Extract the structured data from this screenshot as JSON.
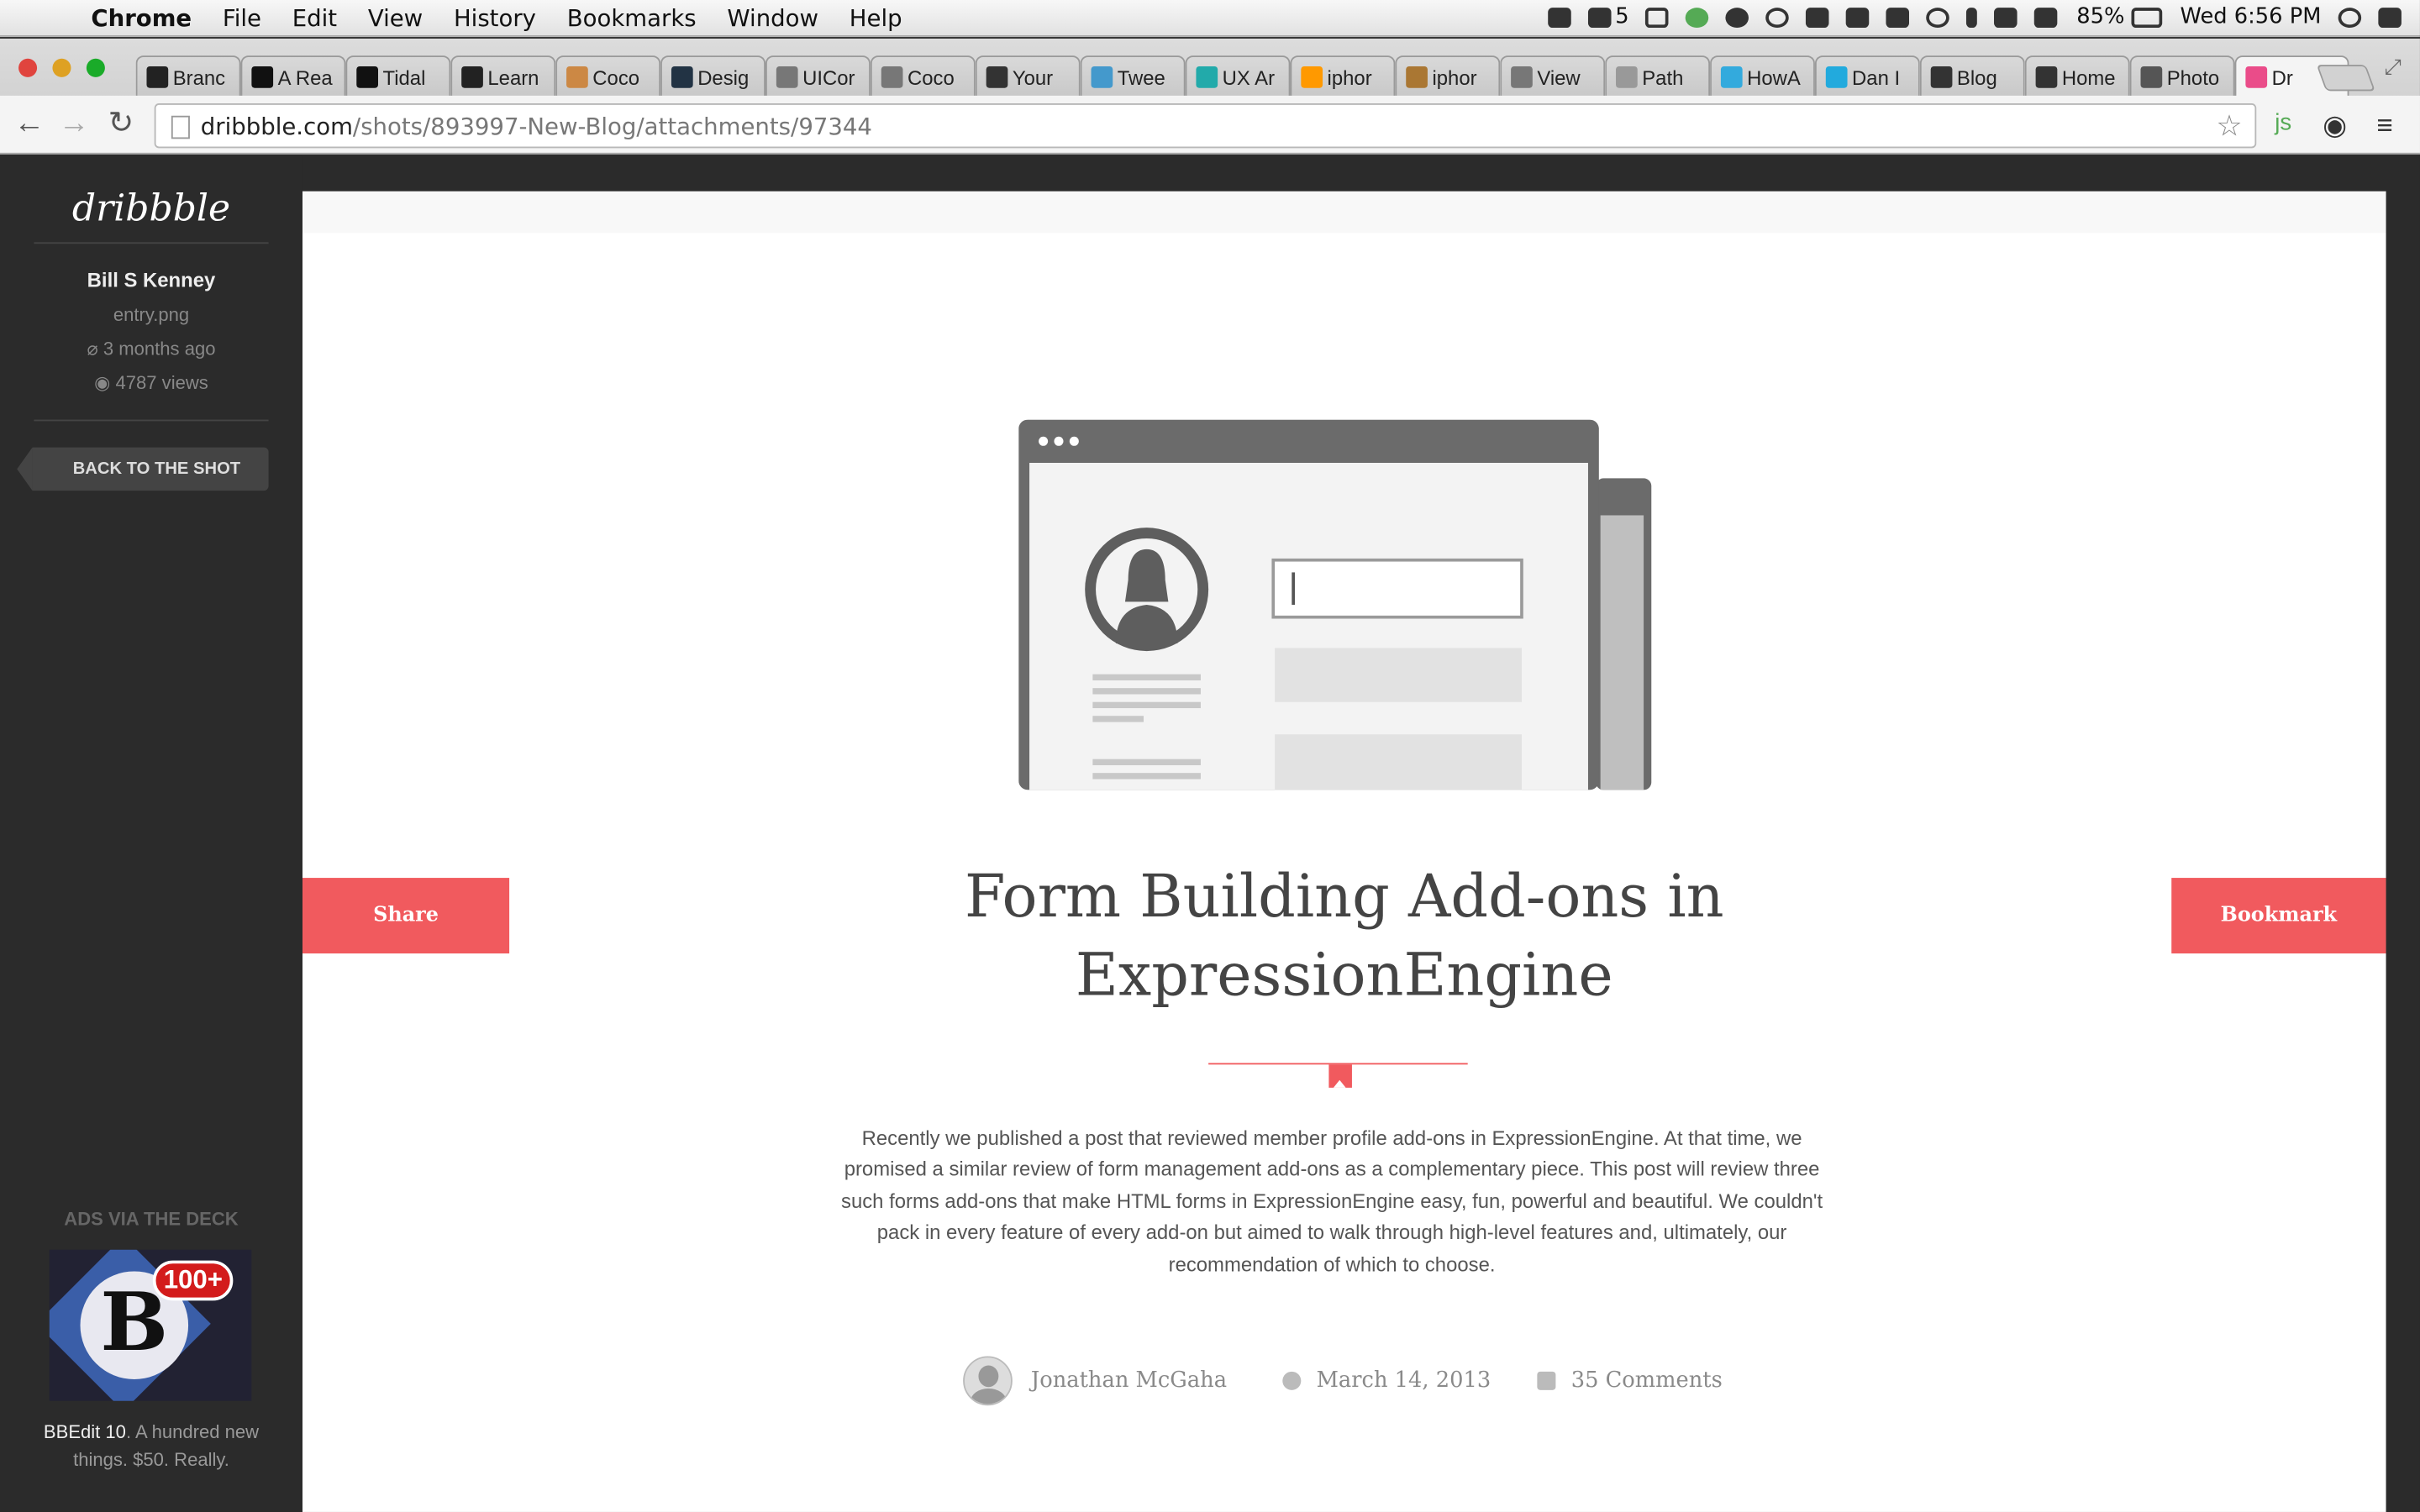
{
  "menubar": {
    "app": "Chrome",
    "menus": [
      "File",
      "Edit",
      "View",
      "History",
      "Bookmarks",
      "Window",
      "Help"
    ],
    "adobe_badge": "5",
    "battery": "85%",
    "clock": "Wed 6:56 PM"
  },
  "tabs": [
    {
      "label": "Branc",
      "color": "#222"
    },
    {
      "label": "A Rea",
      "color": "#111"
    },
    {
      "label": "Tidal",
      "color": "#111"
    },
    {
      "label": "Learn",
      "color": "#222"
    },
    {
      "label": "Coco",
      "color": "#c84"
    },
    {
      "label": "Desig",
      "color": "#234"
    },
    {
      "label": "UICor",
      "color": "#777"
    },
    {
      "label": "Coco",
      "color": "#777"
    },
    {
      "label": "Your",
      "color": "#333"
    },
    {
      "label": "Twee",
      "color": "#49c"
    },
    {
      "label": "UX Ar",
      "color": "#2aa"
    },
    {
      "label": "iphor",
      "color": "#f90"
    },
    {
      "label": "iphor",
      "color": "#a73"
    },
    {
      "label": "View",
      "color": "#777"
    },
    {
      "label": "Path",
      "color": "#999"
    },
    {
      "label": "HowA",
      "color": "#3ad"
    },
    {
      "label": "Dan I",
      "color": "#2ad"
    },
    {
      "label": "Blog",
      "color": "#333"
    },
    {
      "label": "Home",
      "color": "#333"
    },
    {
      "label": "Photo",
      "color": "#555"
    },
    {
      "label": "Dr",
      "color": "#ea4c89"
    }
  ],
  "address": {
    "domain": "dribbble.com",
    "path": "/shots/893997-New-Blog/attachments/97344"
  },
  "toolbar": {
    "ext_js": "js"
  },
  "sidebar": {
    "logo": "dribbble",
    "user": "Bill S Kenney",
    "file": "entry.png",
    "age": "3 months ago",
    "views": "4787 views",
    "back_label": "BACK TO THE SHOT",
    "ads_heading": "ADS VIA THE DECK",
    "ad_badge": "100+",
    "ad_letter": "B",
    "ad_product": "BBEdit 10",
    "ad_text": ". A hundred new things. $50. Really."
  },
  "article": {
    "share_label": "Share",
    "bookmark_label": "Bookmark",
    "title_line1": "Form Building Add-ons in",
    "title_line2": "ExpressionEngine",
    "excerpt": "Recently we published a post that reviewed member profile add-ons in ExpressionEngine. At that time, we promised a similar review of form management add-ons as a complementary piece. This post will review three such forms add-ons that make HTML forms in ExpressionEngine easy, fun, powerful and beautiful. We couldn't pack in every feature of every add-on but aimed to walk through high-level features and, ultimately, our recommendation of which to choose.",
    "author": "Jonathan McGaha",
    "date": "March 14, 2013",
    "comments": "35 Comments"
  },
  "colors": {
    "accent": "#f15a5e",
    "sidebar_bg": "#2b2b2b"
  }
}
